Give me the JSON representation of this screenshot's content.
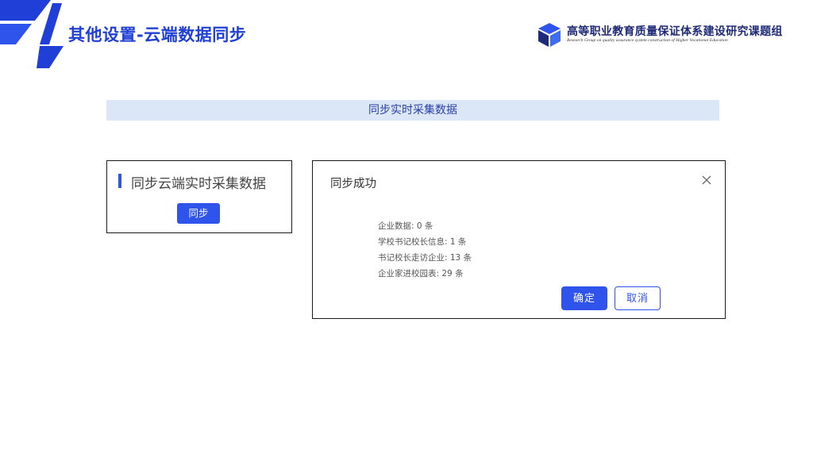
{
  "header": {
    "title": "其他设置-云端数据同步",
    "org_name": "高等职业教育质量保证体系建设研究课题组",
    "org_subtitle": "Research Group on quality assurance system construction of Higher Vocational Education"
  },
  "section": {
    "banner": "同步实时采集数据"
  },
  "sync_panel": {
    "heading": "同步云端实时采集数据",
    "button_label": "同步"
  },
  "dialog": {
    "title": "同步成功",
    "close_icon": "close-icon",
    "results": [
      "企业数据: 0 条",
      "学校书记校长信息: 1 条",
      "书记校长走访企业: 13 条",
      "企业家进校园表: 29 条"
    ],
    "ok_label": "确定",
    "cancel_label": "取消"
  },
  "colors": {
    "accent": "#2f54eb",
    "title_blue": "#1f3fd6",
    "banner_bg": "#dbe7f7"
  }
}
